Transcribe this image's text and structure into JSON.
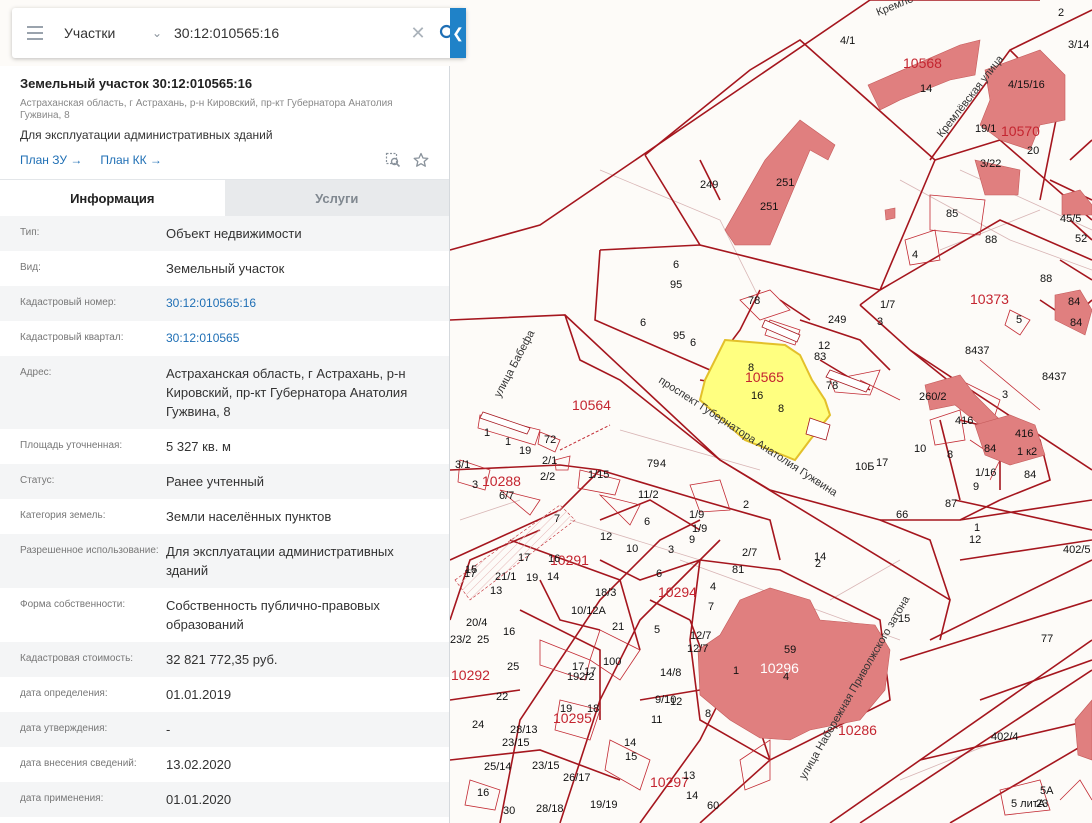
{
  "search": {
    "layer": "Участки",
    "value": "30:12:010565:16"
  },
  "object": {
    "title": "Земельный участок 30:12:010565:16",
    "address": "Астраханская область, г Астрахань, р-н Кировский, пр-кт Губернатора Анатолия Гужвина, 8",
    "purpose": "Для эксплуатации административных зданий",
    "plan_zu": "План ЗУ →",
    "plan_kk": "План КК →"
  },
  "tabs": {
    "info": "Информация",
    "services": "Услуги"
  },
  "rows": [
    {
      "label": "Тип:",
      "value": "Объект недвижимости"
    },
    {
      "label": "Вид:",
      "value": "Земельный участок"
    },
    {
      "label": "Кадастровый номер:",
      "value": "30:12:010565:16",
      "link": true
    },
    {
      "label": "Кадастровый квартал:",
      "value": "30:12:010565",
      "link": true
    },
    {
      "label": "Адрес:",
      "value": "Астраханская область, г Астрахань, р-н Кировский, пр-кт Губернатора Анатолия Гужвина, 8"
    },
    {
      "label": "Площадь уточненная:",
      "value": "5 327 кв. м"
    },
    {
      "label": "Статус:",
      "value": "Ранее учтенный"
    },
    {
      "label": "Категория земель:",
      "value": "Земли населённых пунктов"
    },
    {
      "label": "Разрешенное использование:",
      "value": "Для эксплуатации административных зданий"
    },
    {
      "label": "Форма собственности:",
      "value": "Собственность публично-правовых образований"
    },
    {
      "label": "Кадастровая стоимость:",
      "value": "32 821 772,35 руб."
    },
    {
      "label": "дата определения:",
      "value": "01.01.2019"
    },
    {
      "label": "дата утверждения:",
      "value": "-"
    },
    {
      "label": "дата внесения сведений:",
      "value": "13.02.2020"
    },
    {
      "label": "дата применения:",
      "value": "01.01.2020"
    }
  ],
  "map": {
    "streets": {
      "babefa": "улица Бабефа",
      "prospekt": "проспект Губернатора Анатолия Гужвина",
      "kremlevskaya": "Кремлёвская улица",
      "naberezhnaya": "улица Набережная Приволжского затона",
      "kreml_top": "Кремлё"
    },
    "quarters": [
      "10565",
      "10564",
      "10568",
      "10570",
      "10373",
      "10288",
      "10291",
      "10294",
      "10296",
      "10295",
      "10292",
      "10297",
      "10286"
    ],
    "labels": [
      "4/1",
      "2",
      "3/14",
      "4/15/16",
      "19/1",
      "3/22",
      "20",
      "249",
      "251",
      "251",
      "14",
      "85",
      "88",
      "88",
      "45/5",
      "52",
      "4",
      "84",
      "84",
      "6",
      "95",
      "6",
      "95",
      "6",
      "78",
      "1/7",
      "3",
      "249",
      "12",
      "83",
      "8",
      "16",
      "8",
      "78",
      "5",
      "8437",
      "8437",
      "3",
      "260/2",
      "416",
      "84",
      "1 к2",
      "84",
      "1/16",
      "9",
      "87",
      "1",
      "12",
      "416",
      "1",
      "1",
      "72",
      "19",
      "2/1",
      "2/2",
      "3/1",
      "3",
      "6/7",
      "1/15",
      "79",
      "4",
      "10Б",
      "17",
      "10",
      "8",
      "2",
      "66",
      "402/5",
      "1/9",
      "9",
      "2/7",
      "81",
      "1/9",
      "11/2",
      "6",
      "7",
      "12",
      "10",
      "15",
      "17",
      "16",
      "14",
      "13",
      "21/1",
      "19",
      "17",
      "10/12А",
      "18/3",
      "16",
      "20/4",
      "23/2",
      "25",
      "25",
      "22",
      "24",
      "28/13",
      "23/15",
      "23/15",
      "25/14",
      "26/17",
      "28/18",
      "19/19",
      "16",
      "30",
      "17",
      "100",
      "192/2",
      "21",
      "19",
      "18",
      "17",
      "15",
      "14",
      "13",
      "11",
      "9/10",
      "12",
      "8",
      "12/7",
      "12/7",
      "5",
      "14/8",
      "3",
      "4",
      "6",
      "7",
      "1",
      "59",
      "4",
      "60",
      "14",
      "77",
      "402/4",
      "5А",
      "5 литА",
      "23",
      "15",
      "2",
      "14",
      "2",
      "30",
      "2"
    ]
  }
}
